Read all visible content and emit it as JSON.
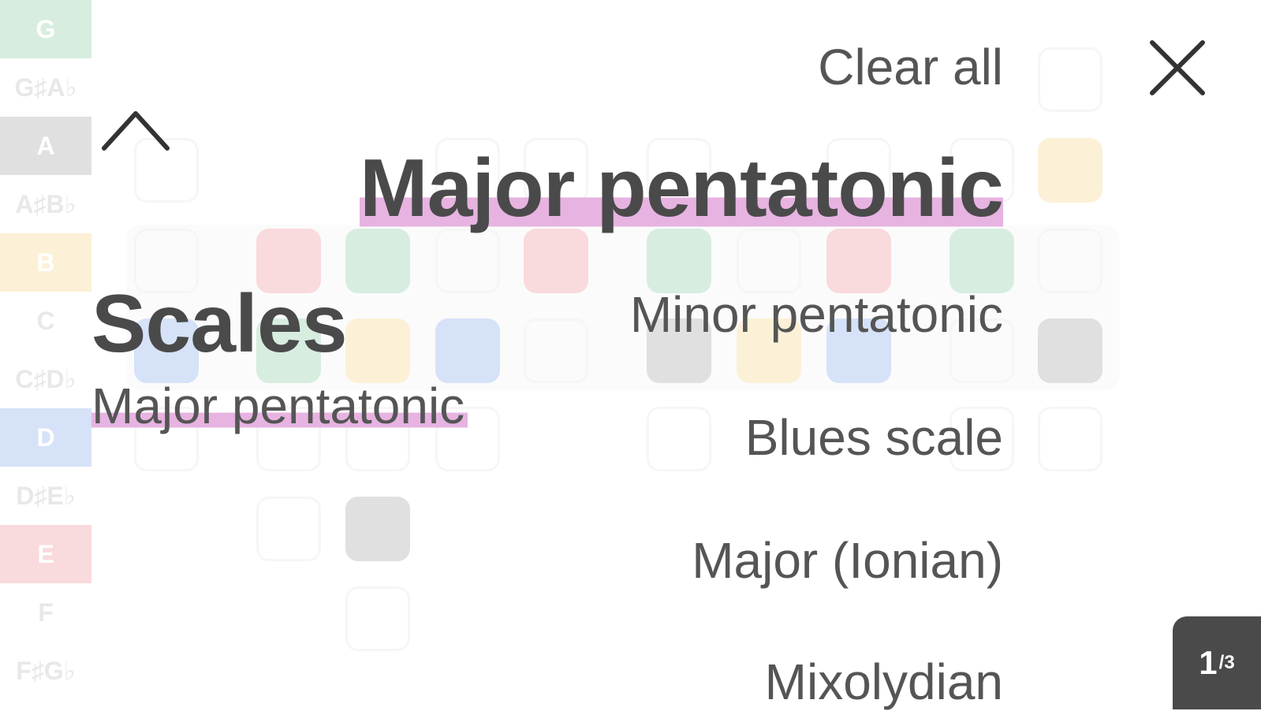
{
  "header": {
    "clear_all_label": "Clear all",
    "close_icon": "close-icon",
    "collapse_icon": "chevron-up-icon"
  },
  "category": {
    "title": "Scales",
    "selected": "Major pentatonic"
  },
  "scales": {
    "items": [
      {
        "label": "Major pentatonic",
        "active": true
      },
      {
        "label": "Minor pentatonic",
        "active": false
      },
      {
        "label": "Blues scale",
        "active": false
      },
      {
        "label": "Major (Ionian)",
        "active": false
      },
      {
        "label": "Mixolydian",
        "active": false
      }
    ]
  },
  "pagination": {
    "current": "1",
    "total": "3"
  },
  "background_notes": {
    "labels": [
      "G",
      "G♯A♭",
      "A",
      "A♯B♭",
      "B",
      "C",
      "C♯D♭",
      "D",
      "D♯E♭",
      "E",
      "F",
      "F♯G♭"
    ],
    "colors": {
      "G": "#4caf78",
      "A": "#777777",
      "B": "#f2c14e",
      "D": "#4a7fe0",
      "E": "#e85c6a"
    }
  },
  "highlight_color": "#e7b3e1"
}
